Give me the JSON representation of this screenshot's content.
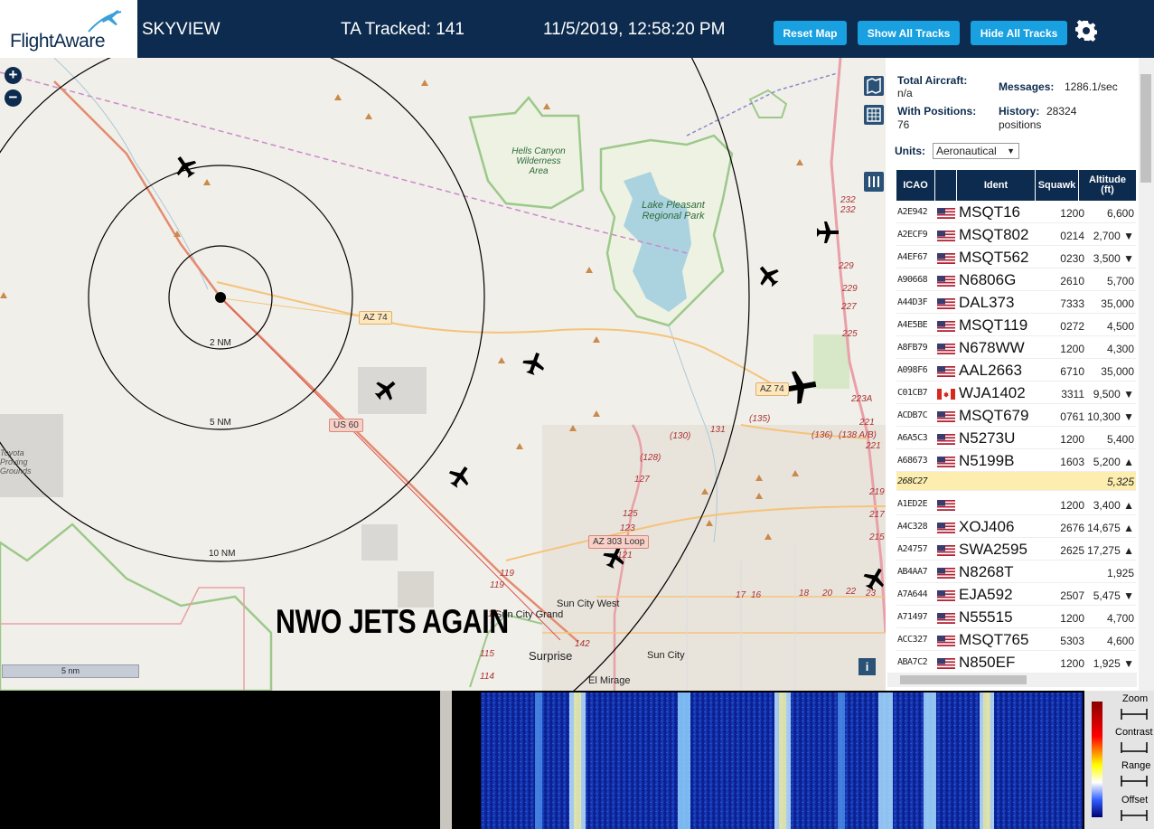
{
  "header": {
    "logo_text": "FlightAware",
    "app_title": "SKYVIEW",
    "tracked": "TA Tracked: 141",
    "datetime": "11/5/2019, 12:58:20 PM",
    "buttons": {
      "reset": "Reset Map",
      "show": "Show All Tracks",
      "hide": "Hide All Tracks"
    },
    "settings_icon": "gear-icon"
  },
  "map": {
    "zoom_in": "+",
    "zoom_out": "−",
    "ring_labels": [
      "2 NM",
      "5 NM",
      "10 NM"
    ],
    "road_labels": [
      "AZ 74",
      "AZ 74",
      "US 60",
      "AZ 303 Loop"
    ],
    "place_labels": [
      "Hells Canyon Wilderness Area",
      "Lake Pleasant Regional Park",
      "Sun City West",
      "Sun City Grand",
      "Surprise",
      "Sun City",
      "El Mirage",
      "Toyota Proving Grounds"
    ],
    "road_numbers": [
      "232",
      "232",
      "229",
      "229",
      "227",
      "225",
      "223A",
      "221",
      "221",
      "219",
      "217",
      "215",
      "131",
      "(130)",
      "(135)",
      "(136)",
      "(138 A/B)",
      "(128)",
      "127",
      "125",
      "123",
      "121",
      "119",
      "119",
      "117",
      "115",
      "114",
      "142",
      "17",
      "16",
      "18",
      "20",
      "22",
      "23"
    ],
    "scale": "5 nm",
    "info": "i",
    "overlay_text": "NWO JETS AGAIN"
  },
  "stats": {
    "total_label": "Total Aircraft:",
    "total_value": "n/a",
    "messages_label": "Messages:",
    "messages_value": "1286.1/sec",
    "positions_label": "With Positions:",
    "positions_value": "76",
    "history_label": "History:",
    "history_value": "28324",
    "history_unit": "positions"
  },
  "units": {
    "label": "Units:",
    "selected": "Aeronautical"
  },
  "table": {
    "headers": [
      "ICAO",
      "Ident",
      "Squawk",
      "Altitude (ft)"
    ],
    "rows": [
      {
        "icao": "A2E942",
        "flag": "us",
        "ident": "MSQT16",
        "squawk": "1200",
        "alt": "6,600"
      },
      {
        "icao": "A2ECF9",
        "flag": "us",
        "ident": "MSQT802",
        "squawk": "0214",
        "alt": "2,700 ▼"
      },
      {
        "icao": "A4EF67",
        "flag": "us",
        "ident": "MSQT562",
        "squawk": "0230",
        "alt": "3,500 ▼"
      },
      {
        "icao": "A90668",
        "flag": "us",
        "ident": "N6806G",
        "squawk": "2610",
        "alt": "5,700"
      },
      {
        "icao": "A44D3F",
        "flag": "us",
        "ident": "DAL373",
        "squawk": "7333",
        "alt": "35,000"
      },
      {
        "icao": "A4E5BE",
        "flag": "us",
        "ident": "MSQT119",
        "squawk": "0272",
        "alt": "4,500"
      },
      {
        "icao": "A8FB79",
        "flag": "us",
        "ident": "N678WW",
        "squawk": "1200",
        "alt": "4,300"
      },
      {
        "icao": "A098F6",
        "flag": "us",
        "ident": "AAL2663",
        "squawk": "6710",
        "alt": "35,000"
      },
      {
        "icao": "C01CB7",
        "flag": "ca",
        "ident": "WJA1402",
        "squawk": "3311",
        "alt": "9,500 ▼"
      },
      {
        "icao": "ACDB7C",
        "flag": "us",
        "ident": "MSQT679",
        "squawk": "0761",
        "alt": "10,300 ▼"
      },
      {
        "icao": "A6A5C3",
        "flag": "us",
        "ident": "N5273U",
        "squawk": "1200",
        "alt": "5,400"
      },
      {
        "icao": "A68673",
        "flag": "us",
        "ident": "N5199B",
        "squawk": "1603",
        "alt": "5,200 ▲"
      },
      {
        "icao": "268C27",
        "flag": "",
        "ident": "",
        "squawk": "",
        "alt": "5,325",
        "selected": true
      },
      {
        "icao": "A1ED2E",
        "flag": "us",
        "ident": "",
        "squawk": "1200",
        "alt": "3,400 ▲"
      },
      {
        "icao": "A4C328",
        "flag": "us",
        "ident": "XOJ406",
        "squawk": "2676",
        "alt": "14,675 ▲"
      },
      {
        "icao": "A24757",
        "flag": "us",
        "ident": "SWA2595",
        "squawk": "2625",
        "alt": "17,275 ▲"
      },
      {
        "icao": "AB4AA7",
        "flag": "us",
        "ident": "N8268T",
        "squawk": "",
        "alt": "1,925"
      },
      {
        "icao": "A7A644",
        "flag": "us",
        "ident": "EJA592",
        "squawk": "2507",
        "alt": "5,475 ▼"
      },
      {
        "icao": "A71497",
        "flag": "us",
        "ident": "N55515",
        "squawk": "1200",
        "alt": "4,700"
      },
      {
        "icao": "ACC327",
        "flag": "us",
        "ident": "MSQT765",
        "squawk": "5303",
        "alt": "4,600"
      },
      {
        "icao": "ABA7C2",
        "flag": "us",
        "ident": "N850EF",
        "squawk": "1200",
        "alt": "1,925 ▼"
      }
    ]
  },
  "waterfall": {
    "controls": [
      "Zoom",
      "Contrast",
      "Range",
      "Offset"
    ]
  },
  "colors": {
    "header_bg": "#0d2b4e",
    "button": "#18a0e0",
    "selected_row": "#fdeeb0"
  }
}
